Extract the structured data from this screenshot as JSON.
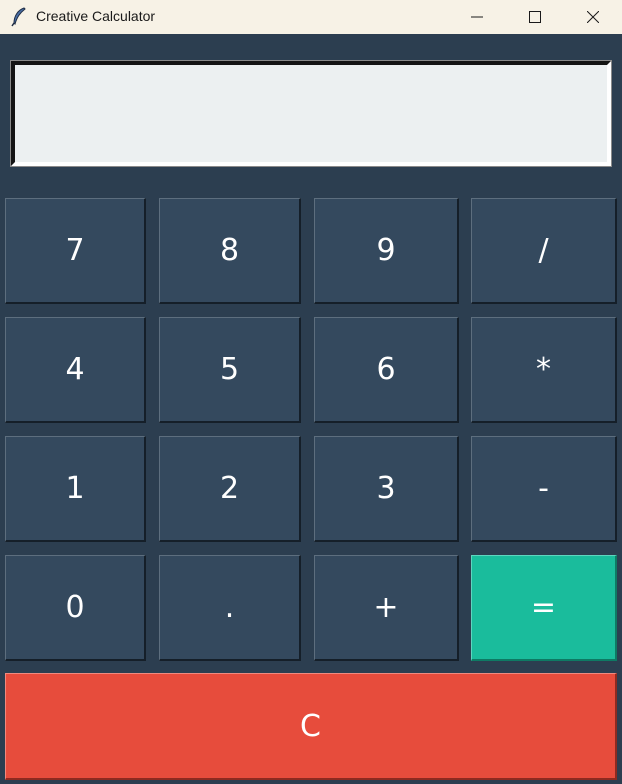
{
  "window": {
    "title": "Creative Calculator",
    "icon": "feather-icon",
    "controls": [
      "minimize-icon",
      "maximize-icon",
      "close-icon"
    ]
  },
  "display": {
    "value": ""
  },
  "keypad": {
    "rows": [
      [
        "7",
        "8",
        "9",
        "/"
      ],
      [
        "4",
        "5",
        "6",
        "*"
      ],
      [
        "1",
        "2",
        "3",
        "-"
      ],
      [
        "0",
        ".",
        "+",
        "="
      ]
    ],
    "clear_label": "C"
  },
  "colors": {
    "background": "#2c3e50",
    "button": "#34495e",
    "equals": "#1abc9c",
    "clear": "#e74c3c",
    "display": "#ecf0f1",
    "titlebar": "#f7f2e6"
  }
}
